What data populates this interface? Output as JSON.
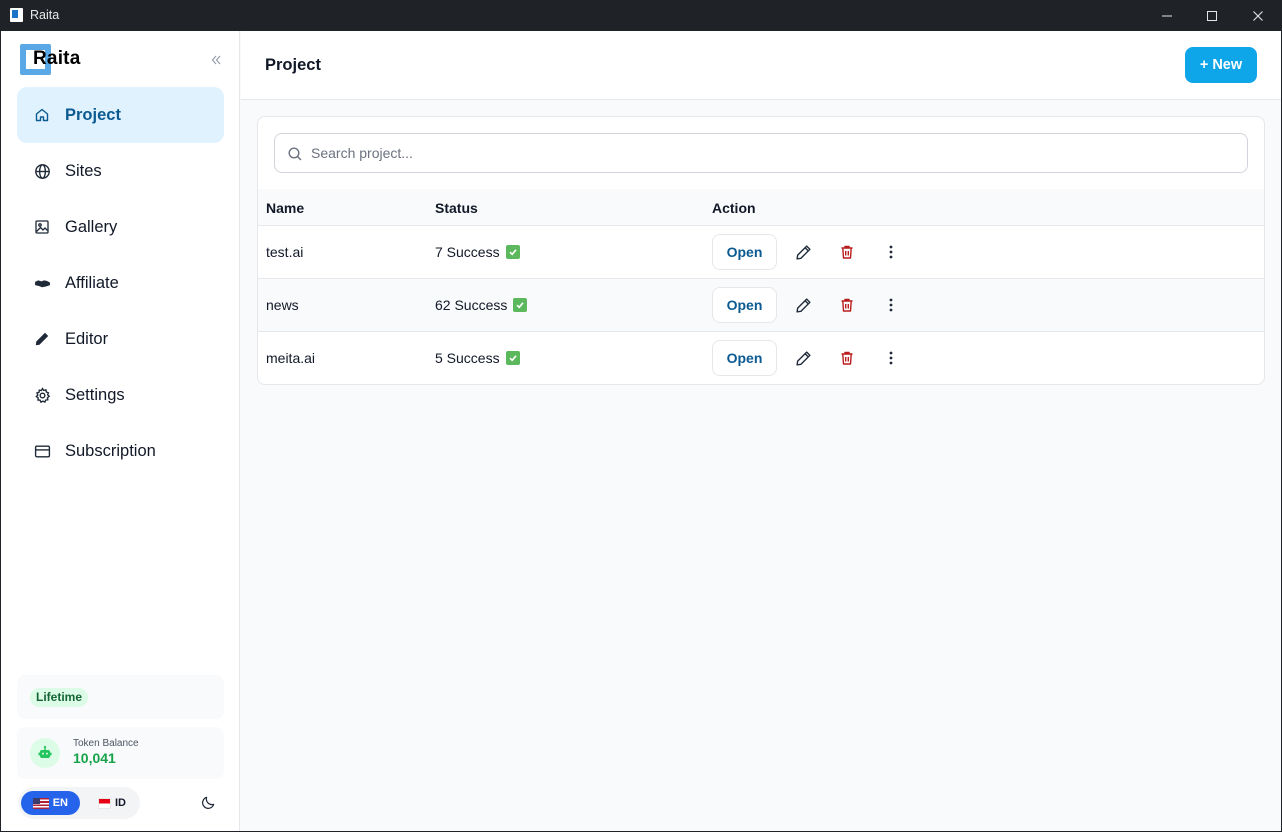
{
  "window": {
    "title": "Raita"
  },
  "sidebar": {
    "logo_text": "Raita",
    "items": [
      {
        "label": "Project",
        "icon": "home-icon",
        "active": true
      },
      {
        "label": "Sites",
        "icon": "globe-icon"
      },
      {
        "label": "Gallery",
        "icon": "image-icon"
      },
      {
        "label": "Affiliate",
        "icon": "handshake-icon"
      },
      {
        "label": "Editor",
        "icon": "pencil-icon"
      },
      {
        "label": "Settings",
        "icon": "gear-icon"
      },
      {
        "label": "Subscription",
        "icon": "credit-card-icon"
      }
    ],
    "plan_badge": "Lifetime",
    "token": {
      "label": "Token Balance",
      "value": "10,041"
    },
    "languages": [
      {
        "code": "EN",
        "active": true
      },
      {
        "code": "ID",
        "active": false
      }
    ]
  },
  "header": {
    "title": "Project",
    "new_button": "+ New"
  },
  "search": {
    "placeholder": "Search project...",
    "value": ""
  },
  "table": {
    "columns": [
      "Name",
      "Status",
      "Action"
    ],
    "open_label": "Open",
    "rows": [
      {
        "name": "test.ai",
        "status": "7 Success"
      },
      {
        "name": "news",
        "status": "62 Success"
      },
      {
        "name": "meita.ai",
        "status": "5 Success"
      }
    ]
  },
  "colors": {
    "accent": "#0ea5e9",
    "active_nav_bg": "#e0f2fe",
    "active_nav_text": "#0b5a91",
    "success": "#16a34a",
    "danger": "#b91c1c",
    "lang_active": "#2563eb"
  }
}
